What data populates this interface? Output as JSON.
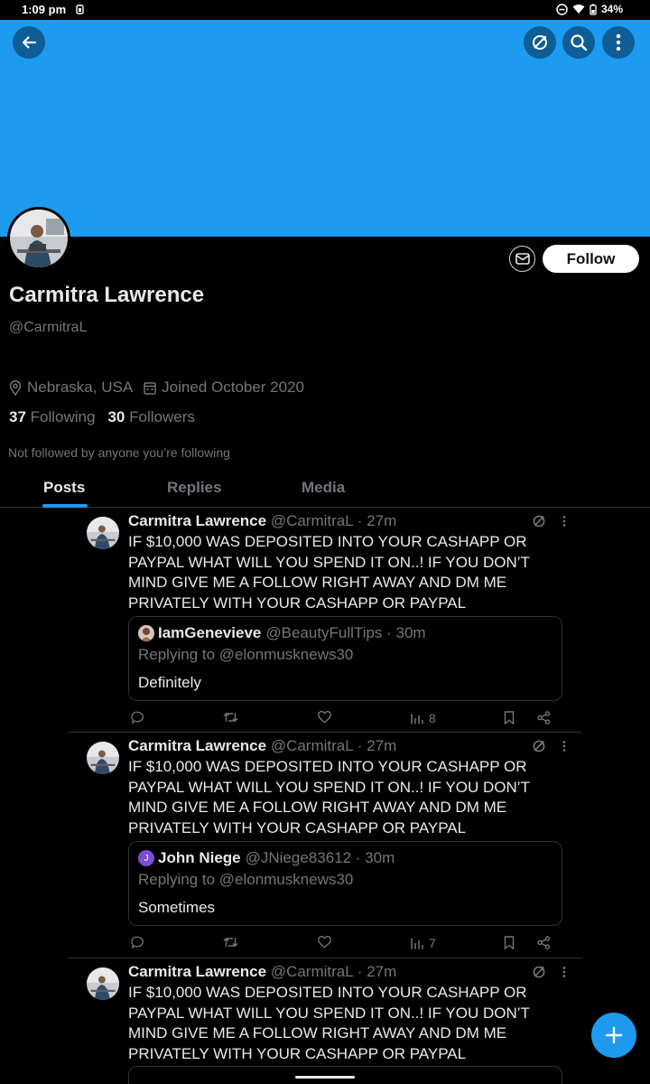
{
  "status_bar": {
    "time": "1:09 pm",
    "battery": "34%"
  },
  "colors": {
    "accent": "#1d9bf0",
    "background": "#000000",
    "text": "#e7e9ea",
    "muted": "#71767b",
    "border": "#2f3336"
  },
  "header": {
    "icons": [
      "back-arrow-icon",
      "sync-icon",
      "search-icon",
      "more-vertical-icon"
    ]
  },
  "profile": {
    "display_name": "Carmitra Lawrence",
    "handle": "@CarmitraL",
    "location": "Nebraska, USA",
    "joined": "Joined October 2020",
    "following_count": "37",
    "following_label": "Following",
    "followers_count": "30",
    "followers_label": "Followers",
    "not_followed": "Not followed by anyone you’re following",
    "follow_label": "Follow"
  },
  "tabs": [
    {
      "label": "Posts",
      "active": true
    },
    {
      "label": "Replies",
      "active": false
    },
    {
      "label": "Media",
      "active": false
    }
  ],
  "tweets": [
    {
      "name": "Carmitra Lawrence",
      "meta": "@CarmitraL · 27m",
      "text": "IF $10,000 WAS DEPOSITED INTO YOUR CASHAPP OR PAYPAL WHAT WILL YOU SPEND IT ON..! IF YOU DON’T MIND GIVE ME A FOLLOW RIGHT AWAY AND DM ME PRIVATELY WITH YOUR CASHAPP OR PAYPAL",
      "quote": {
        "avatar_letter": "",
        "name": "IamGenevieve",
        "meta": "@BeautyFullTips · 30m",
        "replying": "Replying to @elonmusknews30",
        "text": "Definitely"
      },
      "views": "8"
    },
    {
      "name": "Carmitra Lawrence",
      "meta": "@CarmitraL · 27m",
      "text": "IF $10,000 WAS DEPOSITED INTO YOUR CASHAPP OR PAYPAL WHAT WILL YOU SPEND IT ON..! IF YOU DON’T MIND GIVE ME A FOLLOW RIGHT AWAY AND DM ME PRIVATELY WITH YOUR CASHAPP OR PAYPAL",
      "quote": {
        "avatar_letter": "J",
        "name": "John Niege",
        "meta": "@JNiege83612 · 30m",
        "replying": "Replying to @elonmusknews30",
        "text": "Sometimes"
      },
      "views": "7"
    },
    {
      "name": "Carmitra Lawrence",
      "meta": "@CarmitraL · 27m",
      "text": "IF $10,000 WAS DEPOSITED INTO YOUR CASHAPP OR PAYPAL WHAT WILL YOU SPEND IT ON..! IF YOU DON’T MIND GIVE ME A FOLLOW RIGHT AWAY AND DM ME PRIVATELY WITH YOUR CASHAPP OR PAYPAL"
    }
  ]
}
